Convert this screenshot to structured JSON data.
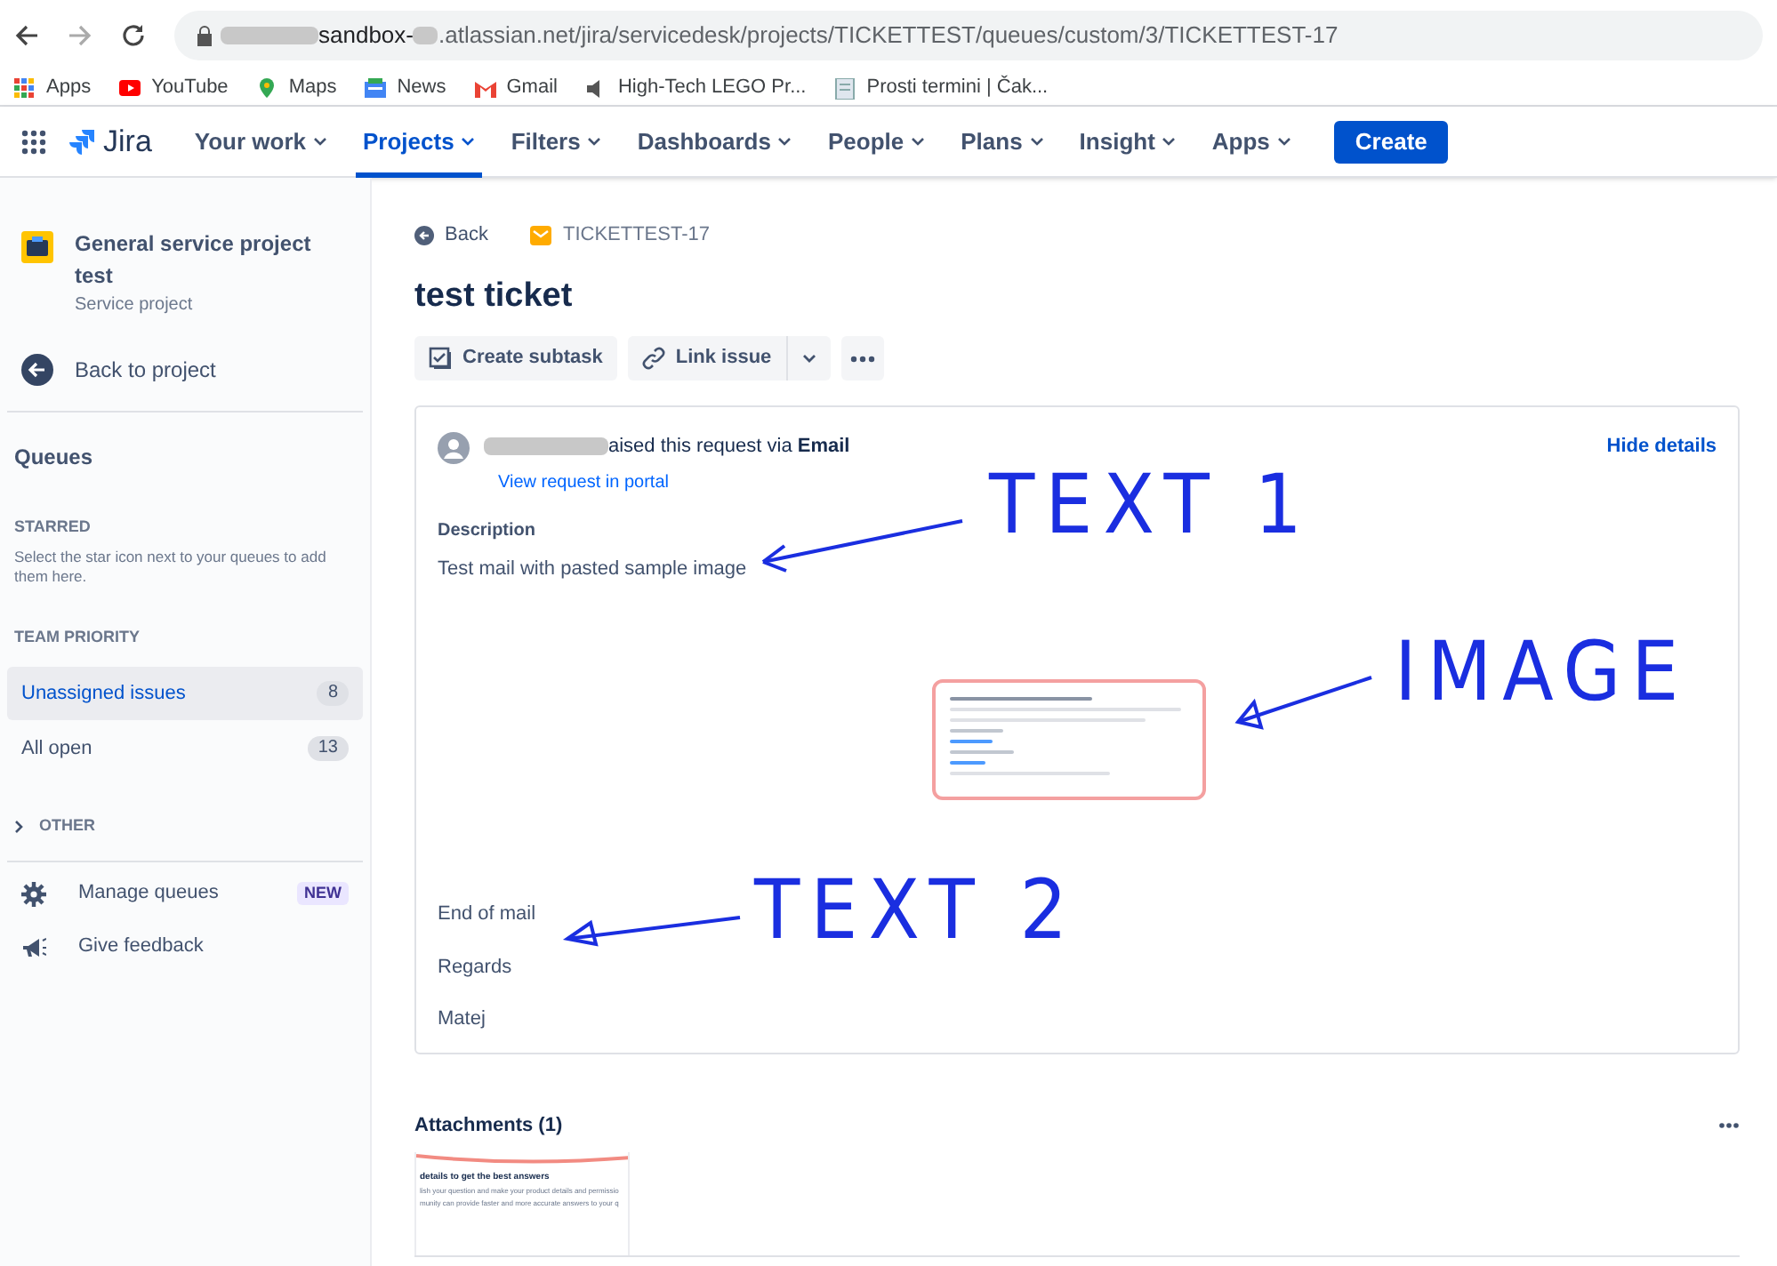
{
  "browser": {
    "url_start": "sandbox-",
    "url_rest": ".atlassian.net/jira/servicedesk/projects/TICKETTEST/queues/custom/3/TICKETTEST-17",
    "bookmarks": [
      {
        "kind": "apps",
        "label": "Apps"
      },
      {
        "kind": "youtube",
        "label": "YouTube"
      },
      {
        "kind": "maps",
        "label": "Maps"
      },
      {
        "kind": "news",
        "label": "News"
      },
      {
        "kind": "gmail",
        "label": "Gmail"
      },
      {
        "kind": "speaker",
        "label": "High-Tech LEGO Pr..."
      },
      {
        "kind": "doc",
        "label": "Prosti termini | Čak..."
      }
    ]
  },
  "topnav": {
    "logo": "Jira",
    "items": [
      {
        "label": "Your work",
        "selected": false
      },
      {
        "label": "Projects",
        "selected": true
      },
      {
        "label": "Filters",
        "selected": false
      },
      {
        "label": "Dashboards",
        "selected": false
      },
      {
        "label": "People",
        "selected": false
      },
      {
        "label": "Plans",
        "selected": false
      },
      {
        "label": "Insight",
        "selected": false
      },
      {
        "label": "Apps",
        "selected": false
      }
    ],
    "create": "Create"
  },
  "sidebar": {
    "project_name": "General service project test",
    "project_type": "Service project",
    "back": "Back to project",
    "queues_heading": "Queues",
    "starred_heading": "STARRED",
    "starred_hint": "Select the star icon next to your queues to add them here.",
    "team_heading": "TEAM PRIORITY",
    "queues": [
      {
        "label": "Unassigned issues",
        "count": "8",
        "selected": true
      },
      {
        "label": "All open",
        "count": "13",
        "selected": false
      }
    ],
    "other": {
      "label": "OTHER",
      "expanded": false
    },
    "footer": [
      {
        "kind": "gear",
        "label": "Manage queues",
        "badge": "NEW"
      },
      {
        "kind": "megaphone",
        "label": "Give feedback"
      }
    ]
  },
  "issue": {
    "back": "Back",
    "key": "TICKETTEST-17",
    "title": "test ticket",
    "actions": [
      "Create subtask",
      "Link issue"
    ],
    "request": {
      "raised": "aised this request via **Email**",
      "portal_link": "View request in portal",
      "hide": "Hide details"
    },
    "description_label": "Description",
    "intro": "Test mail with pasted sample image",
    "closing": [
      "End of mail",
      "Regards",
      "Matej"
    ]
  },
  "attachments": {
    "title": "Attachments (1)",
    "thumbnail_lines": [
      "details to get the best answers",
      "lish your question and make your product details and permissio",
      "munity can provide faster and more accurate answers to your q"
    ]
  },
  "annotations": [
    {
      "text": "TEXT 1"
    },
    {
      "text": "IMAGE"
    },
    {
      "text": "TEXT 2"
    }
  ]
}
